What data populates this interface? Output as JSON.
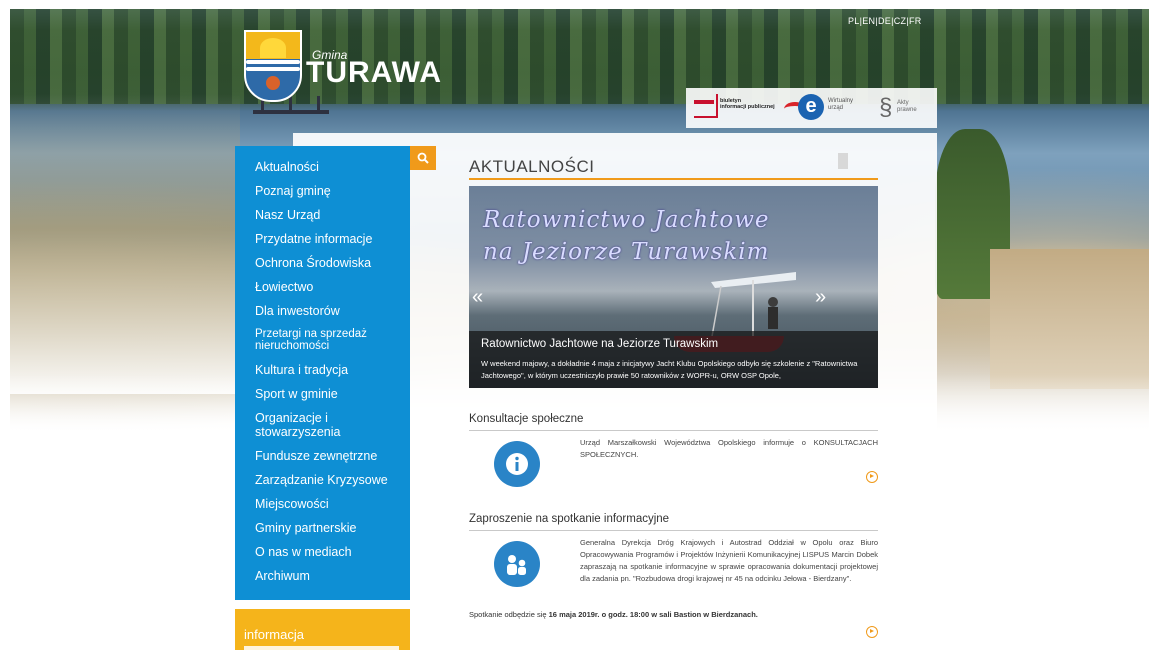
{
  "languages": [
    "PL",
    "EN",
    "DE",
    "CZ",
    "FR"
  ],
  "brand": {
    "small": "Gmina",
    "name": "TURAWA"
  },
  "partners": {
    "bip": [
      "biuletyn",
      "informacji publicznej"
    ],
    "eurzad": [
      "Wirtualny",
      "urząd"
    ],
    "akty": [
      "Akty",
      "prawne"
    ]
  },
  "sidebar": {
    "items": [
      "Aktualności",
      "Poznaj gminę",
      "Nasz Urząd",
      "Przydatne informacje",
      "Ochrona Środowiska",
      "Łowiectwo",
      "Dla inwestorów",
      "Przetargi na sprzedaż nieruchomości",
      "Kultura i tradycja",
      "Sport w gminie",
      "Organizacje i stowarzyszenia",
      "Fundusze zewnętrzne",
      "Zarządzanie Kryzysowe",
      "Miejscowości",
      "Gminy partnerskie",
      "O nas w mediach",
      "Archiwum"
    ]
  },
  "info_box": {
    "title": "informacja"
  },
  "section": {
    "title": "AKTUALNOŚCI"
  },
  "slider": {
    "script_line1": "Ratownictwo Jachtowe",
    "script_line2": "na Jeziorze Turawskim",
    "prev": "«",
    "next": "»",
    "caption_title": "Ratownictwo Jachtowe na Jeziorze Turawskim",
    "caption_text": "W weekend majowy, a dokładnie 4 maja z inicjatywy Jacht Klubu Opolskiego odbyło się szkolenie z \"Ratownictwa Jachtowego\", w którym uczestniczyło prawie 50 ratowników z WOPR-u, ORW OSP Opole,"
  },
  "news": [
    {
      "title": "Konsultacje społeczne",
      "icon": "info-icon",
      "text": "Urząd Marszałkowski Województwa Opolskiego informuje o KONSULTACJACH SPOŁECZNYCH."
    },
    {
      "title": "Zaproszenie na spotkanie informacyjne",
      "icon": "people-icon",
      "text": "Generalna Dyrekcja Dróg Krajowych i Autostrad Oddział w Opolu oraz Biuro Opracowywania Programów i Projektów Inżynierii Komunikacyjnej LISPUS Marcin Dobek zapraszają na spotkanie informacyjne w sprawie opracowania dokumentacji projektowej dla zadania pn. \"Rozbudowa drogi krajowej nr 45 na odcinku Jełowa - Bierdzany\".",
      "foot_prefix": "Spotkanie odbędzie się ",
      "foot_bold": "16 maja 2019r. o godz. 18:00 w sali Bastion w Bierdzanach."
    }
  ],
  "colors": {
    "accent": "#f09a1a",
    "sidebar": "#0e8fd4",
    "info_box": "#f5b41b",
    "icon_blue": "#2a84c7"
  }
}
